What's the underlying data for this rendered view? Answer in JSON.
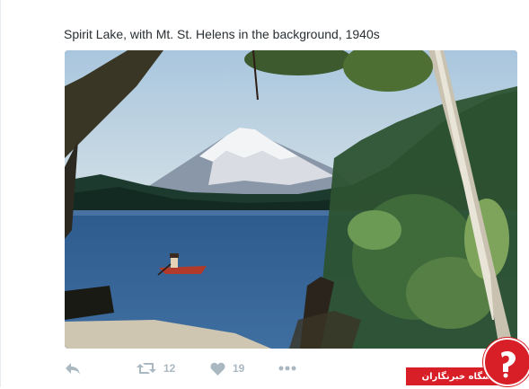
{
  "tweet": {
    "text": "Spirit Lake, with Mt. St. Helens in the background, 1940s"
  },
  "actions": {
    "reply_icon": "reply-icon",
    "retweet_icon": "retweet-icon",
    "retweet_count": "12",
    "like_icon": "heart-icon",
    "like_count": "19",
    "more_icon": "more-dots-icon"
  },
  "watermark": {
    "label": "باشگاه خبرنگاران"
  },
  "colors": {
    "action_gray": "#aab8c2",
    "text": "#292f33",
    "watermark_red": "#d81e26"
  }
}
